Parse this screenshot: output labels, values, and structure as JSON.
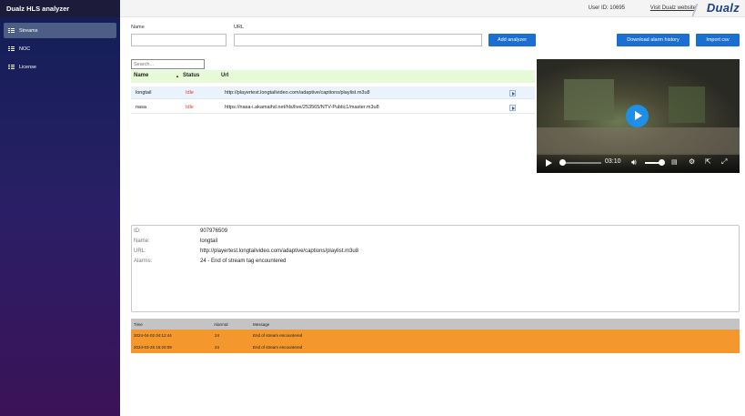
{
  "app": {
    "title": "Dualz HLS analyzer"
  },
  "sidebar": {
    "items": [
      {
        "label": "Streams",
        "active": true
      },
      {
        "label": "NOC",
        "active": false
      },
      {
        "label": "License",
        "active": false
      }
    ]
  },
  "topbar": {
    "user_id": "User ID: 10695",
    "visit_link": "Visit Dualz website",
    "logo": "Dualz"
  },
  "form": {
    "name_label": "Name",
    "url_label": "URL",
    "name_value": "",
    "url_value": "",
    "add_button": "Add analyzer",
    "download_button": "Download alarm history",
    "import_button": "Import csv"
  },
  "table": {
    "search_placeholder": "Search...",
    "columns": [
      "Name",
      "Status",
      "Url"
    ],
    "sort_indicator": "▲",
    "rows": [
      {
        "name": "longtail",
        "status": "Idle",
        "url": "http://playertest.longtailvideo.com/adaptive/captions/playlist.m3u8"
      },
      {
        "name": "nasa",
        "status": "Idle",
        "url": "https://nasa-i.akamaihd.net/hls/live/253565/NTV-Public1/master.m3u8"
      }
    ]
  },
  "player": {
    "time": "03:10",
    "progress": 0.0
  },
  "detail": {
    "id_label": "ID:",
    "id_value": "907976509",
    "name_label": "Name:",
    "name_value": "longtail",
    "url_label": "URL:",
    "url_value": "http://playertest.longtailvideo.com/adaptive/captions/playlist.m3u8",
    "alarms_label": "Alarms:",
    "alarms_value": "24 - End of stream tag encountered"
  },
  "alarms": {
    "columns": [
      "Time",
      "AlarmId",
      "Message"
    ],
    "rows": [
      {
        "time": "2024-04-02 04:12:44",
        "id": "24",
        "message": "End of stream encountered"
      },
      {
        "time": "2024-03-28 15:20:09",
        "id": "24",
        "message": "End of stream encountered"
      }
    ],
    "row_color": "#f4982e"
  },
  "colors": {
    "accent": "#1b6fd0",
    "idle": "#e03a2a",
    "table_header": "#e6fad8"
  }
}
